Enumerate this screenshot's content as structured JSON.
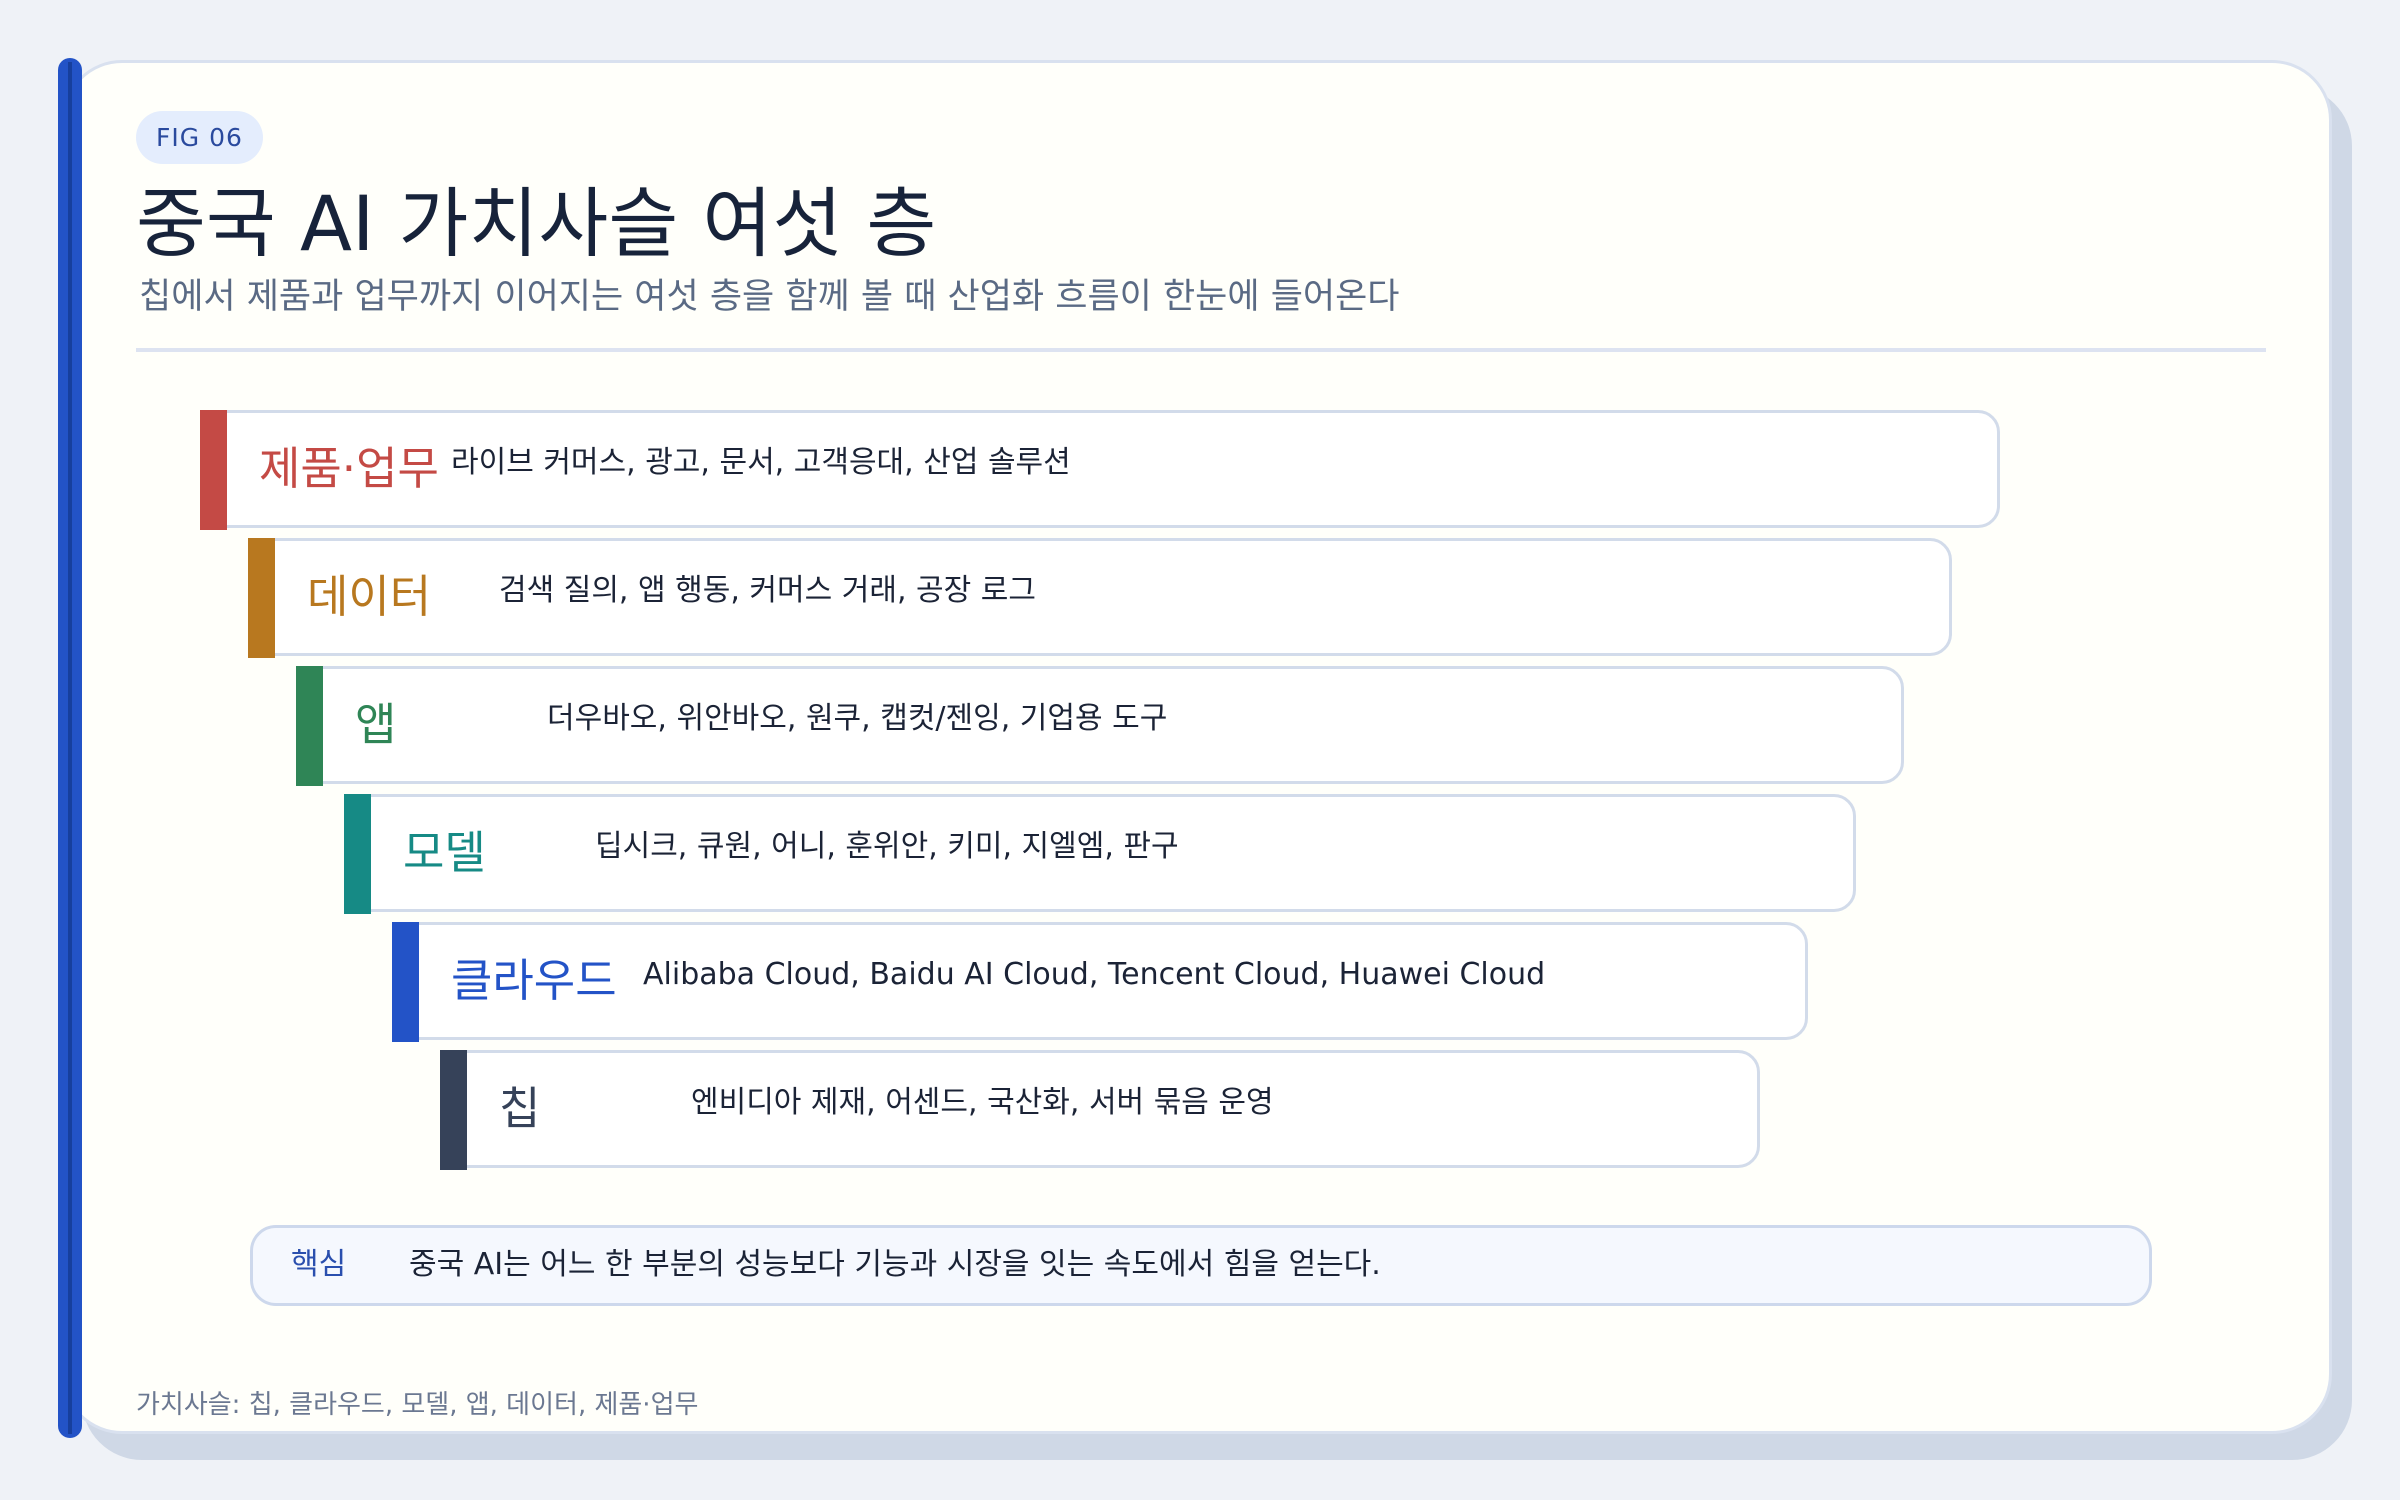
{
  "figure": {
    "tag": "FIG 06",
    "title": "중국 AI 가치사슬 여섯 층",
    "subtitle": "칩에서 제품과 업무까지 이어지는 여섯 층을 함께 볼 때 산업화 흐름이 한눈에 들어온다"
  },
  "layers": [
    {
      "name": "제품·업무",
      "desc": "라이브 커머스, 광고, 문서, 고객응대, 산업 솔루션",
      "color": "#c44a45"
    },
    {
      "name": "데이터",
      "desc": "검색 질의, 앱 행동, 커머스 거래, 공장 로그",
      "color": "#b8781f"
    },
    {
      "name": "앱",
      "desc": "더우바오, 위안바오, 원쿠, 캡컷/젠잉, 기업용 도구",
      "color": "#2f8556"
    },
    {
      "name": "모델",
      "desc": "딥시크, 큐원, 어니, 훈위안, 키미, 지엘엠, 판구",
      "color": "#168a85"
    },
    {
      "name": "클라우드",
      "desc": "Alibaba Cloud, Baidu AI Cloud, Tencent Cloud, Huawei Cloud",
      "color": "#2353c7"
    },
    {
      "name": "칩",
      "desc": "엔비디아 제재, 어센드, 국산화, 서버 묶음 운영",
      "color": "#364259"
    }
  ],
  "callout": {
    "key": "핵심",
    "message": "중국 AI는 어느 한 부분의 성능보다 기능과 시장을 잇는 속도에서 힘을 얻는다."
  },
  "footnote": "가치사슬: 칩, 클라우드, 모델, 앱, 데이터, 제품·업무"
}
